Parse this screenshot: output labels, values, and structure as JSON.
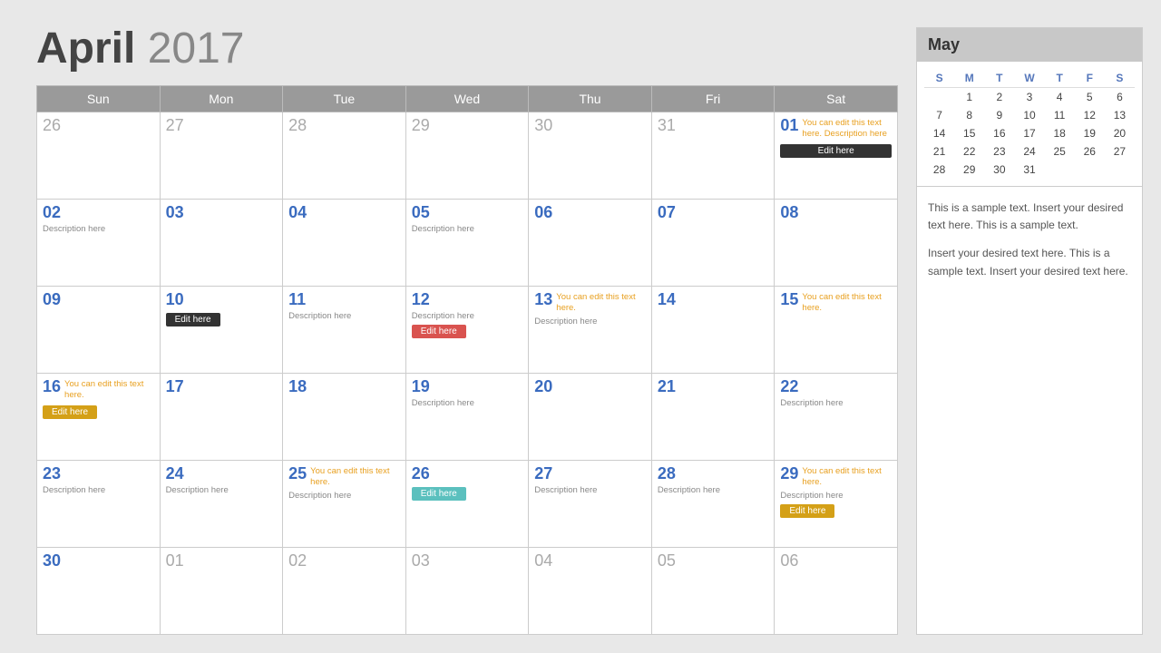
{
  "header": {
    "month": "April",
    "year": "2017"
  },
  "weekdays": [
    "Sun",
    "Mon",
    "Tue",
    "Wed",
    "Thu",
    "Fri",
    "Sat"
  ],
  "weeks": [
    [
      {
        "num": "26",
        "muted": true,
        "desc": "",
        "note": "",
        "btn": null
      },
      {
        "num": "27",
        "muted": true,
        "desc": "",
        "note": "",
        "btn": null
      },
      {
        "num": "28",
        "muted": true,
        "desc": "",
        "note": "",
        "btn": null
      },
      {
        "num": "29",
        "muted": true,
        "desc": "",
        "note": "",
        "btn": null
      },
      {
        "num": "30",
        "muted": true,
        "desc": "",
        "note": "",
        "btn": null
      },
      {
        "num": "31",
        "muted": true,
        "desc": "",
        "note": "",
        "btn": null
      },
      {
        "num": "01",
        "muted": false,
        "desc": "",
        "note": "You can edit this text here. Description here",
        "btn": {
          "label": "Edit here",
          "style": "dark full"
        }
      }
    ],
    [
      {
        "num": "02",
        "muted": false,
        "desc": "Description here",
        "note": "",
        "btn": null
      },
      {
        "num": "03",
        "muted": false,
        "desc": "",
        "note": "",
        "btn": null
      },
      {
        "num": "04",
        "muted": false,
        "desc": "",
        "note": "",
        "btn": null
      },
      {
        "num": "05",
        "muted": false,
        "desc": "Description here",
        "note": "",
        "btn": null
      },
      {
        "num": "06",
        "muted": false,
        "desc": "",
        "note": "",
        "btn": null
      },
      {
        "num": "07",
        "muted": false,
        "desc": "",
        "note": "",
        "btn": null
      },
      {
        "num": "08",
        "muted": false,
        "desc": "",
        "note": "",
        "btn": null
      }
    ],
    [
      {
        "num": "09",
        "muted": false,
        "desc": "",
        "note": "",
        "btn": null
      },
      {
        "num": "10",
        "muted": false,
        "desc": "",
        "note": "",
        "btn": {
          "label": "Edit here",
          "style": "dark"
        }
      },
      {
        "num": "11",
        "muted": false,
        "desc": "Description here",
        "note": "",
        "btn": null
      },
      {
        "num": "12",
        "muted": false,
        "desc": "Description here",
        "note": "",
        "btn": {
          "label": "Edit here",
          "style": "red"
        }
      },
      {
        "num": "13",
        "muted": false,
        "desc": "Description here",
        "note": "You can edit this text here.",
        "btn": null
      },
      {
        "num": "14",
        "muted": false,
        "desc": "",
        "note": "",
        "btn": null
      },
      {
        "num": "15",
        "muted": false,
        "desc": "",
        "note": "You can edit this text here.",
        "btn": null
      }
    ],
    [
      {
        "num": "16",
        "muted": false,
        "desc": "",
        "note": "You can edit this text here.",
        "btn": {
          "label": "Edit here",
          "style": "gold"
        }
      },
      {
        "num": "17",
        "muted": false,
        "desc": "",
        "note": "",
        "btn": null
      },
      {
        "num": "18",
        "muted": false,
        "desc": "",
        "note": "",
        "btn": null
      },
      {
        "num": "19",
        "muted": false,
        "desc": "Description here",
        "note": "",
        "btn": null
      },
      {
        "num": "20",
        "muted": false,
        "desc": "",
        "note": "",
        "btn": null
      },
      {
        "num": "21",
        "muted": false,
        "desc": "",
        "note": "",
        "btn": null
      },
      {
        "num": "22",
        "muted": false,
        "desc": "Description here",
        "note": "",
        "btn": null
      }
    ],
    [
      {
        "num": "23",
        "muted": false,
        "desc": "Description here",
        "note": "",
        "btn": null
      },
      {
        "num": "24",
        "muted": false,
        "desc": "Description here",
        "note": "",
        "btn": null
      },
      {
        "num": "25",
        "muted": false,
        "desc": "Description here",
        "note": "You can edit this text here.",
        "btn": null
      },
      {
        "num": "26",
        "muted": false,
        "desc": "",
        "note": "",
        "btn": {
          "label": "Edit here",
          "style": "teal"
        }
      },
      {
        "num": "27",
        "muted": false,
        "desc": "Description here",
        "note": "",
        "btn": null
      },
      {
        "num": "28",
        "muted": false,
        "desc": "Description here",
        "note": "",
        "btn": null
      },
      {
        "num": "29",
        "muted": false,
        "desc": "Description here",
        "note": "You can edit this text here.",
        "btn": {
          "label": "Edit here",
          "style": "gold"
        }
      }
    ],
    [
      {
        "num": "30",
        "muted": false,
        "desc": "",
        "note": "",
        "btn": null
      },
      {
        "num": "01",
        "muted": true,
        "desc": "",
        "note": "",
        "btn": null
      },
      {
        "num": "02",
        "muted": true,
        "desc": "",
        "note": "",
        "btn": null
      },
      {
        "num": "03",
        "muted": true,
        "desc": "",
        "note": "",
        "btn": null
      },
      {
        "num": "04",
        "muted": true,
        "desc": "",
        "note": "",
        "btn": null
      },
      {
        "num": "05",
        "muted": true,
        "desc": "",
        "note": "",
        "btn": null
      },
      {
        "num": "06",
        "muted": true,
        "desc": "",
        "note": "",
        "btn": null
      }
    ]
  ],
  "sidebar": {
    "mini_month": "May",
    "mini_weekdays": [
      "S",
      "M",
      "T",
      "W",
      "T",
      "F",
      "S"
    ],
    "mini_weeks": [
      [
        "",
        "1",
        "2",
        "3",
        "4",
        "5",
        "6"
      ],
      [
        "7",
        "8",
        "9",
        "10",
        "11",
        "12",
        "13"
      ],
      [
        "14",
        "15",
        "16",
        "17",
        "18",
        "19",
        "20"
      ],
      [
        "21",
        "22",
        "23",
        "24",
        "25",
        "26",
        "27"
      ],
      [
        "28",
        "29",
        "30",
        "31",
        "",
        "",
        ""
      ]
    ],
    "text1": "This is a sample text. Insert your desired text here. This is a sample text.",
    "text2": "Insert your desired text here. This is a sample text. Insert your desired text here."
  }
}
